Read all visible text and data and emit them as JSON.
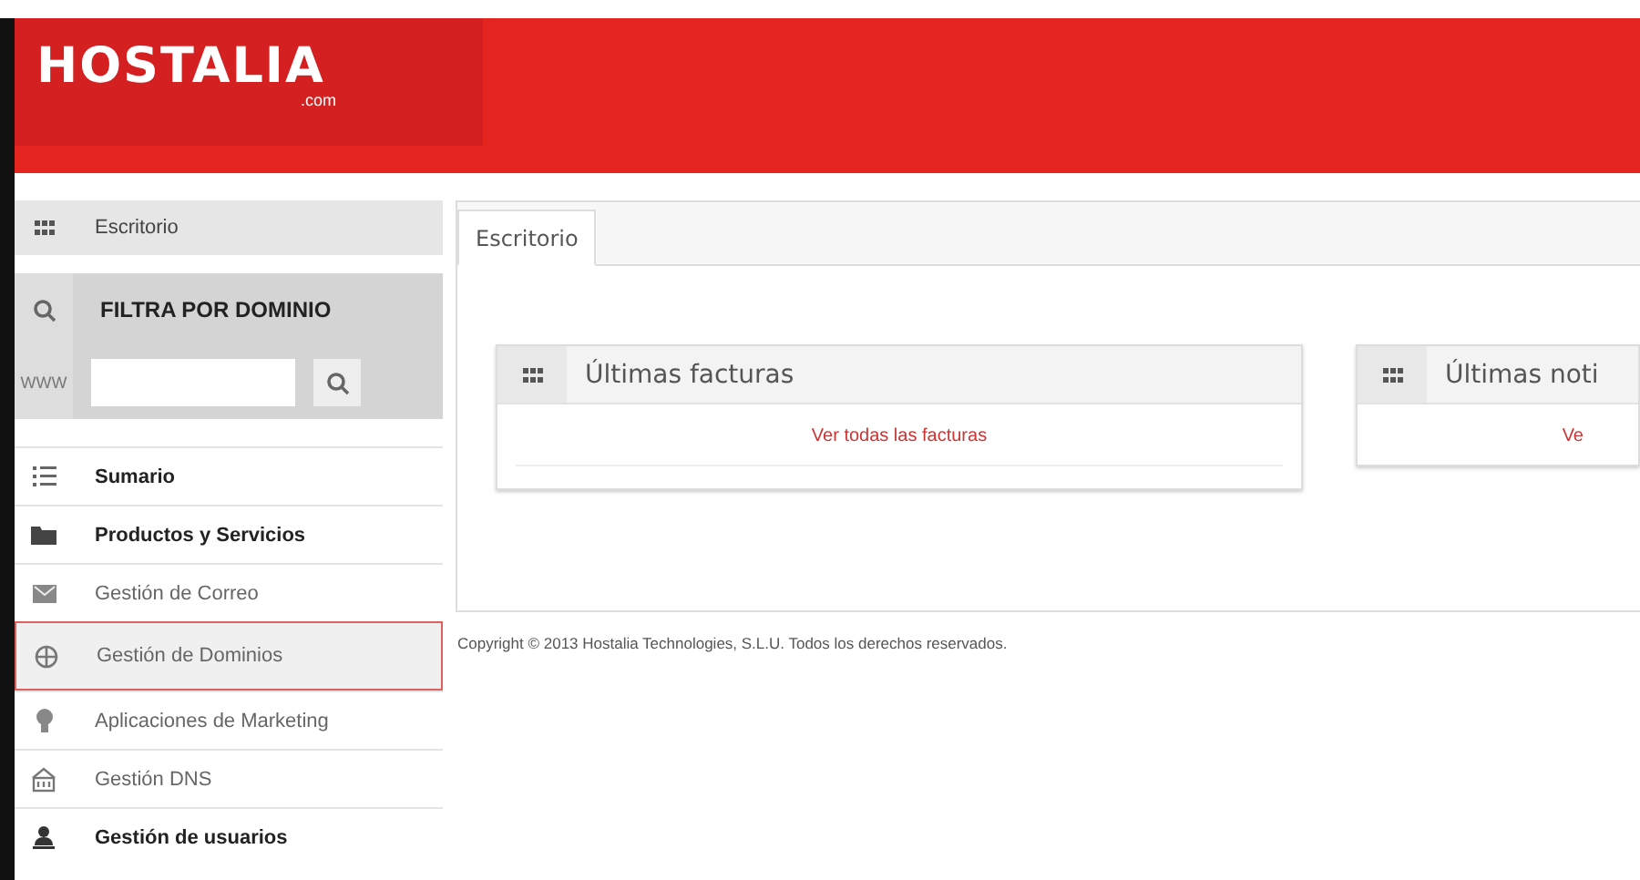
{
  "header": {
    "logo": "HOSTALIA",
    "logo_suffix": ".com"
  },
  "sidebar": {
    "desk_item": {
      "label": "Escritorio"
    },
    "filter": {
      "title": "FILTRA POR DOMINIO",
      "prefix": "WWW"
    },
    "items": [
      {
        "label": "Sumario",
        "kind": "section",
        "selected": false
      },
      {
        "label": "Productos y Servicios",
        "kind": "section",
        "selected": false
      },
      {
        "label": "Gestión de Correo",
        "kind": "link",
        "selected": false
      },
      {
        "label": "Gestión de Dominios",
        "kind": "link",
        "selected": true
      },
      {
        "label": "Aplicaciones de Marketing",
        "kind": "link",
        "selected": false
      },
      {
        "label": "Gestión DNS",
        "kind": "link",
        "selected": false
      },
      {
        "label": "Gestión de usuarios",
        "kind": "section",
        "selected": false
      }
    ]
  },
  "tabs": [
    {
      "label": "Escritorio",
      "selected": true
    }
  ],
  "cards": [
    {
      "title": "Últimas facturas",
      "link": "Ver todas las facturas"
    },
    {
      "title": "Últimas noti",
      "link": "Ve"
    }
  ],
  "footer": {
    "copyright": "Copyright © 2013 Hostalia Technologies, S.L.U. Todos los derechos reservados."
  }
}
